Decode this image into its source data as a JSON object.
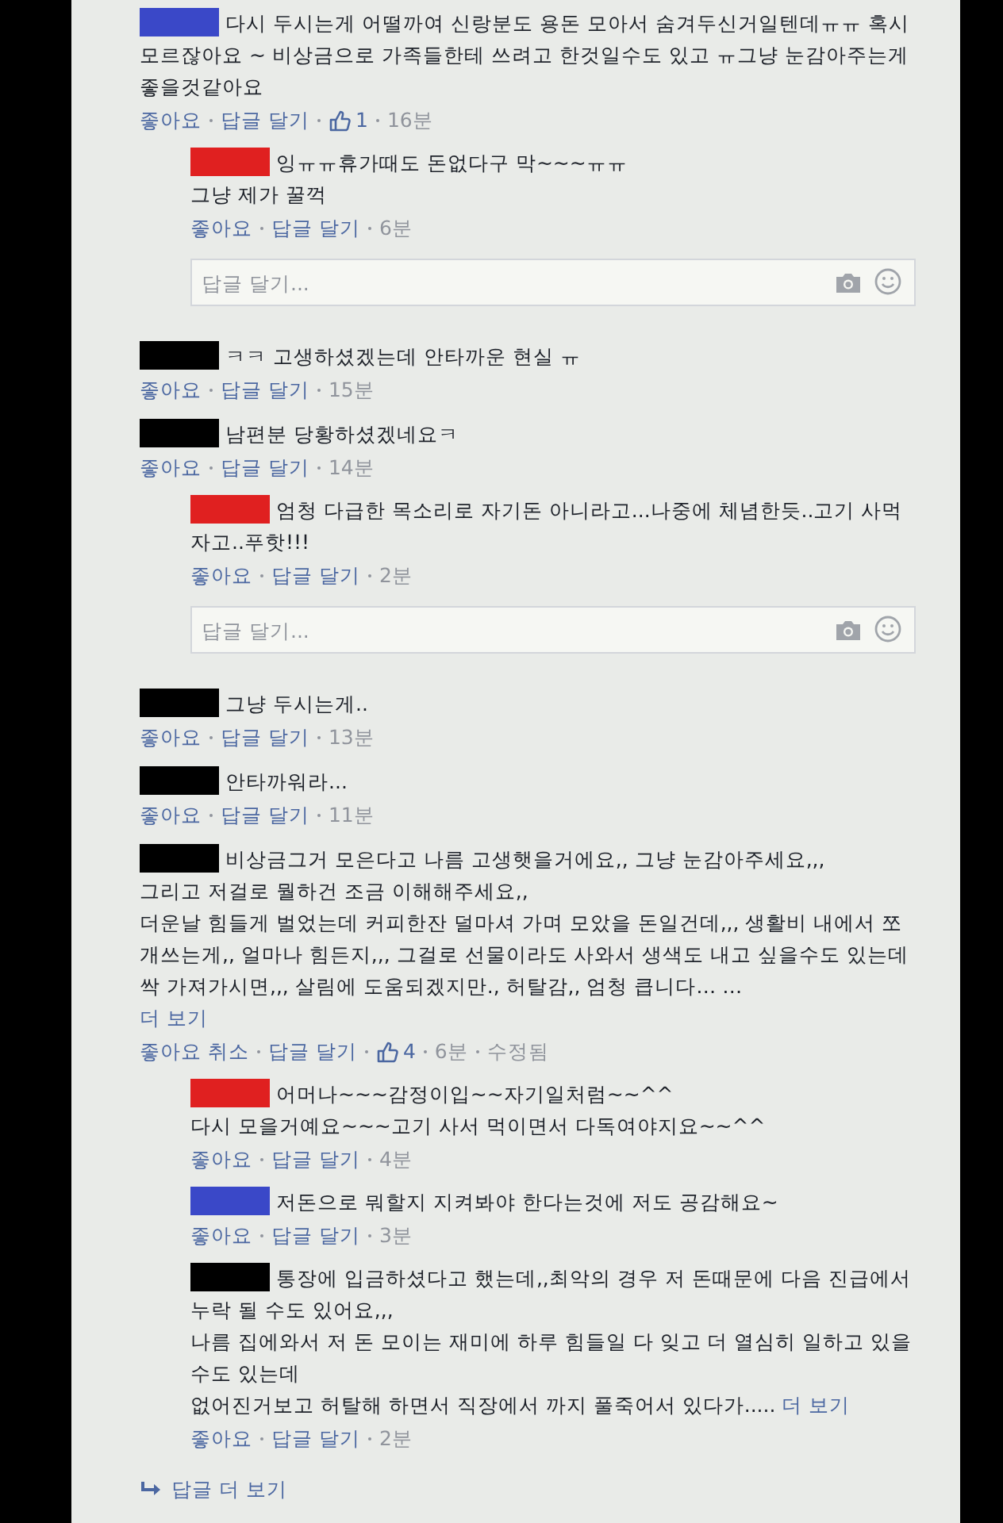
{
  "comments": [
    {
      "color": "#3a48c8",
      "text": "다시 두시는게 어떨까여 신랑분도 용돈 모아서 숨겨두신거일텐데ㅠㅠ 혹시 모르잖아요 ~ 비상금으로 가족들한테 쓰려고 한것일수도 있고 ㅠ그냥 눈감아주는게 좋을것같아요",
      "like_action": "좋아요",
      "reply_action": "답글 달기",
      "likes": "1",
      "time": "16분",
      "replies": [
        {
          "color": "#e02020",
          "text": "잉ㅠㅠ휴가때도 돈없다구 막~~~ㅠㅠ\n그냥 제가 꿀꺽",
          "like_action": "좋아요",
          "reply_action": "답글 달기",
          "time": "6분"
        }
      ],
      "reply_box": {
        "placeholder": "답글 달기..."
      }
    },
    {
      "color": "#000000",
      "text": "ㅋㅋ 고생하셨겠는데 안타까운 현실 ㅠ",
      "like_action": "좋아요",
      "reply_action": "답글 달기",
      "time": "15분"
    },
    {
      "color": "#000000",
      "text": "남편분 당황하셨겠네요ㅋ",
      "like_action": "좋아요",
      "reply_action": "답글 달기",
      "time": "14분",
      "replies": [
        {
          "color": "#e02020",
          "text": "엄청 다급한 목소리로 자기돈 아니라고...나중에 체념한듯..고기 사먹자고..푸핫!!!",
          "like_action": "좋아요",
          "reply_action": "답글 달기",
          "time": "2분"
        }
      ],
      "reply_box": {
        "placeholder": "답글 달기..."
      }
    },
    {
      "color": "#000000",
      "text": "그냥 두시는게..",
      "like_action": "좋아요",
      "reply_action": "답글 달기",
      "time": "13분"
    },
    {
      "color": "#000000",
      "text": "안타까워라...",
      "like_action": "좋아요",
      "reply_action": "답글 달기",
      "time": "11분"
    },
    {
      "color": "#000000",
      "text": "비상금그거 모은다고 나름 고생햇을거에요,, 그냥 눈감아주세요,,,\n그리고 저걸로 뭘하건 조금 이해해주세요,,\n더운날 힘들게 벌었는데 커피한잔 덜마셔 가며 모았을 돈일건데,,, 생활비 내에서 쪼개쓰는게,, 얼마나 힘든지,,, 그걸로 선물이라도 사와서 생색도 내고 싶을수도 있는데 싹 가져가시면,,, 살림에 도움되겠지만., 허탈감,, 엄청 큽니다… …",
      "see_more": "더 보기",
      "see_more_newline": true,
      "like_action": "좋아요 취소",
      "reply_action": "답글 달기",
      "likes": "4",
      "time": "6분",
      "edited": "수정됨",
      "replies": [
        {
          "color": "#e02020",
          "text": "어머나~~~감정이입~~자기일처럼~~^^\n다시 모을거예요~~~고기 사서 먹이면서 다독여야지요~~^^",
          "like_action": "좋아요",
          "reply_action": "답글 달기",
          "time": "4분"
        },
        {
          "color": "#3a48c8",
          "text": "저돈으로 뭐할지 지켜봐야 한다는것에 저도 공감해요~",
          "like_action": "좋아요",
          "reply_action": "답글 달기",
          "time": "3분"
        },
        {
          "color": "#000000",
          "text": "통장에 입금하셨다고 했는데,,최악의 경우 저 돈때문에 다음 진급에서 누락 될 수도 있어요,,,\n나름 집에와서 저 돈 모이는 재미에 하루 힘들일 다 잊고 더 열심히 일하고 있을 수도 있는데\n없어진거보고 허탈해 하면서 직장에서 까지 풀죽어서 있다가.....",
          "see_more": "더 보기",
          "see_more_newline": false,
          "like_action": "좋아요",
          "reply_action": "답글 달기",
          "time": "2분"
        }
      ],
      "more_replies": "답글 더 보기"
    }
  ]
}
